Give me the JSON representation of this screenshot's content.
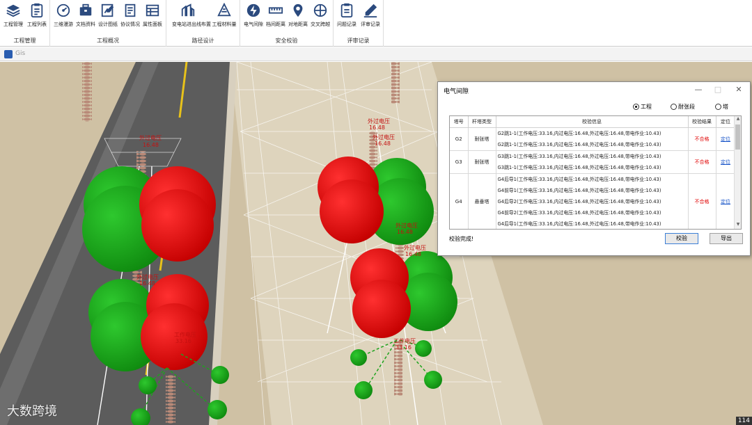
{
  "ribbon": {
    "groups": [
      {
        "label": "工程管理",
        "buttons": [
          {
            "label": "工程管理",
            "icon": "layers-icon"
          },
          {
            "label": "工程列表",
            "icon": "clipboard-list-icon"
          }
        ]
      },
      {
        "label": "工程概况",
        "buttons": [
          {
            "label": "三维漫游",
            "icon": "dashboard-icon"
          },
          {
            "label": "文档资料",
            "icon": "briefcase-icon"
          },
          {
            "label": "设计图纸",
            "icon": "drawing-icon"
          },
          {
            "label": "协议情况",
            "icon": "document-icon"
          },
          {
            "label": "属性面板",
            "icon": "panel-icon"
          }
        ]
      },
      {
        "label": "路径设计",
        "buttons": [
          {
            "label": "变电站进出线布置",
            "icon": "substation-icon"
          },
          {
            "label": "工程材料量",
            "icon": "material-icon"
          }
        ]
      },
      {
        "label": "安全校验",
        "buttons": [
          {
            "label": "电气间隙",
            "icon": "electric-icon"
          },
          {
            "label": "档间距离",
            "icon": "ruler-icon"
          },
          {
            "label": "对地距离",
            "icon": "map-pin-icon"
          },
          {
            "label": "交叉跨越",
            "icon": "crosshair-icon"
          }
        ]
      },
      {
        "label": "评审记录",
        "buttons": [
          {
            "label": "问题记录",
            "icon": "problem-record-icon"
          },
          {
            "label": "评审记录",
            "icon": "pen-icon"
          }
        ]
      }
    ]
  },
  "gis_window": {
    "title": "Gis"
  },
  "scene": {
    "labels": [
      "外过电压",
      "16.48",
      "外过电压",
      "16.48",
      "外过电压",
      "16.48",
      "外过电压",
      "16.48",
      "外过电压",
      "16.48",
      "外过电压",
      "16.48",
      "工作电压",
      "33.16",
      "工作电压",
      "33.16"
    ],
    "watermark": "大数跨境",
    "corner_number": "114"
  },
  "dialog": {
    "title": "电气间隙",
    "radios": [
      {
        "label": "工程",
        "checked": true
      },
      {
        "label": "耐张段",
        "checked": false
      },
      {
        "label": "塔",
        "checked": false
      }
    ],
    "columns": [
      "塔号",
      "杆塔类型",
      "校验信息",
      "校验结果",
      "定位"
    ],
    "rows": [
      {
        "tower": "G2",
        "type": "耐张塔",
        "info": [
          "G2跳1-1(工作电压:33.16,内过电压:16.48,外过电压:16.48,带电作业:10.43)",
          "G2跳1-1(工作电压:33.16,内过电压:16.48,外过电压:16.48,带电作业:10.43)"
        ],
        "result": "不合格",
        "locate": "定位"
      },
      {
        "tower": "G3",
        "type": "耐张塔",
        "info": [
          "G3跳1-1(工作电压:33.16,内过电压:16.48,外过电压:16.48,带电作业:10.43)",
          "G3跳1-1(工作电压:33.16,内过电压:16.48,外过电压:16.48,带电作业:10.43)"
        ],
        "result": "不合格",
        "locate": "定位"
      },
      {
        "tower": "G4",
        "type": "悬垂塔",
        "info": [
          "G4后导1(工作电压:33.16,内过电压:16.48,外过电压:16.48,带电作业:10.43)",
          "G4前导1(工作电压:33.16,内过电压:16.48,外过电压:16.48,带电作业:10.43)",
          "G4后导2(工作电压:33.16,内过电压:16.48,外过电压:16.48,带电作业:10.43)",
          "G4前导2(工作电压:33.16,内过电压:16.48,外过电压:16.48,带电作业:10.43)",
          "G4后导1(工作电压:33.16,内过电压:16.48,外过电压:16.48,带电作业:10.43)"
        ],
        "result": "不合格",
        "locate": "定位"
      }
    ],
    "status": "校验完成!",
    "buttons": {
      "verify": "校验",
      "export": "导出"
    },
    "window_controls": {
      "minimize": "—",
      "maximize": "□",
      "close": "✕"
    }
  },
  "colors": {
    "fail": "#e00000",
    "link": "#1a56c9",
    "sphere_red": "#e60000",
    "sphere_green": "#1aa31a",
    "ground": "#c9b99a",
    "road": "#5a5a5a"
  }
}
